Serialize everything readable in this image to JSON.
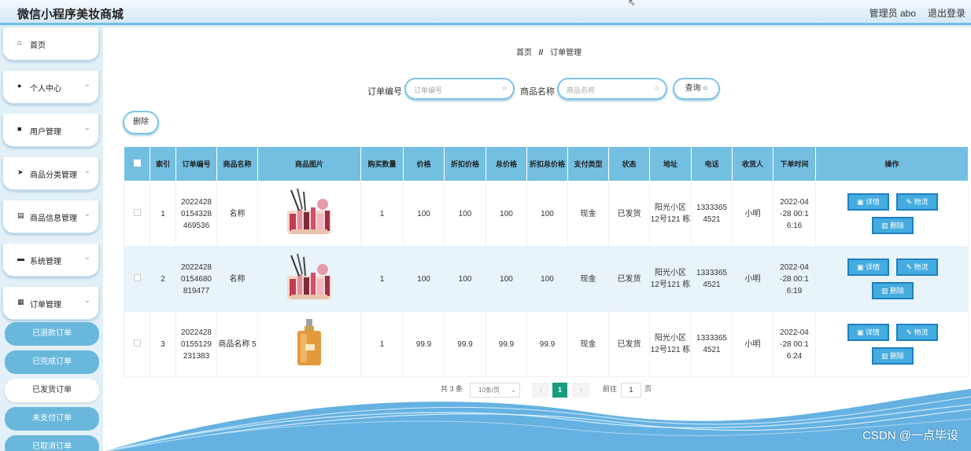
{
  "header": {
    "title": "微信小程序美妆商城",
    "admin": "管理员 abo",
    "logout": "退出登录"
  },
  "sidebar": {
    "items": [
      {
        "label": "首页",
        "icon": "home-icon",
        "glyph": "⌂"
      },
      {
        "label": "个人中心",
        "icon": "user-icon",
        "glyph": "●",
        "chev": "⌄"
      },
      {
        "label": "用户管理",
        "icon": "thumb-icon",
        "glyph": "■",
        "chev": "⌄"
      },
      {
        "label": "商品分类管理",
        "icon": "send-icon",
        "glyph": "➤",
        "chev": "⌄"
      },
      {
        "label": "商品信息管理",
        "icon": "file-icon",
        "glyph": "▤",
        "chev": "⌄"
      },
      {
        "label": "系统管理",
        "icon": "ticket-icon",
        "glyph": "▬",
        "chev": "⌄"
      },
      {
        "label": "订单管理",
        "icon": "grid-icon",
        "glyph": "▦",
        "chev": "⌄"
      }
    ],
    "sub_items": [
      "已退款订单",
      "已完成订单",
      "已发货订单",
      "未支付订单",
      "已取消订单"
    ]
  },
  "breadcrumb": {
    "home": "首页",
    "sep": "//",
    "current": "订单管理"
  },
  "search": {
    "order_label": "订单编号",
    "order_placeholder": "订单编号",
    "product_label": "商品名称",
    "product_placeholder": "商品名称",
    "query_label": "查询 ○"
  },
  "toolbar": {
    "delete_label": "删除"
  },
  "table": {
    "headers": [
      "索引",
      "订单编号",
      "商品名称",
      "商品图片",
      "购买数量",
      "价格",
      "折扣价格",
      "总价格",
      "折扣总价格",
      "支付类型",
      "状态",
      "地址",
      "电话",
      "收货人",
      "下单时间",
      "操作"
    ],
    "rows": [
      {
        "index": "1",
        "order_no": "2022428 0154328 469536",
        "name": "名称",
        "qty": "1",
        "price": "100",
        "discount": "100",
        "total": "100",
        "discount_total": "100",
        "pay": "现金",
        "status": "已发货",
        "address": "阳光小区 12号121 栋",
        "phone": "1333365 4521",
        "receiver": "小明",
        "time": "2022-04 -28 00:1 6:16"
      },
      {
        "index": "2",
        "order_no": "2022428 0154680 819477",
        "name": "名称",
        "qty": "1",
        "price": "100",
        "discount": "100",
        "total": "100",
        "discount_total": "100",
        "pay": "现金",
        "status": "已发货",
        "address": "阳光小区 12号121 栋",
        "phone": "1333365 4521",
        "receiver": "小明",
        "time": "2022-04 -28 00:1 6:19"
      },
      {
        "index": "3",
        "order_no": "2022428 0155129 231383",
        "name": "商品名称 5",
        "qty": "1",
        "price": "99.9",
        "discount": "99.9",
        "total": "99.9",
        "discount_total": "99.9",
        "pay": "现金",
        "status": "已发货",
        "address": "阳光小区 12号121 栋",
        "phone": "1333365 4521",
        "receiver": "小明",
        "time": "2022-04 -28 00:1 6:24"
      }
    ],
    "actions": {
      "detail": "详情",
      "logistics": "物流",
      "delete": "删除"
    }
  },
  "pagination": {
    "total": "共 3 条",
    "page_size": "10条/页",
    "current_page": "1",
    "goto_label": "前往",
    "goto_value": "1",
    "page_suffix": "页",
    "prev": "‹",
    "next": "›"
  },
  "watermark": "CSDN @一点毕设",
  "colors": {
    "accent": "#73bfe2",
    "button": "#45ace0",
    "active_page": "#179c7e"
  }
}
